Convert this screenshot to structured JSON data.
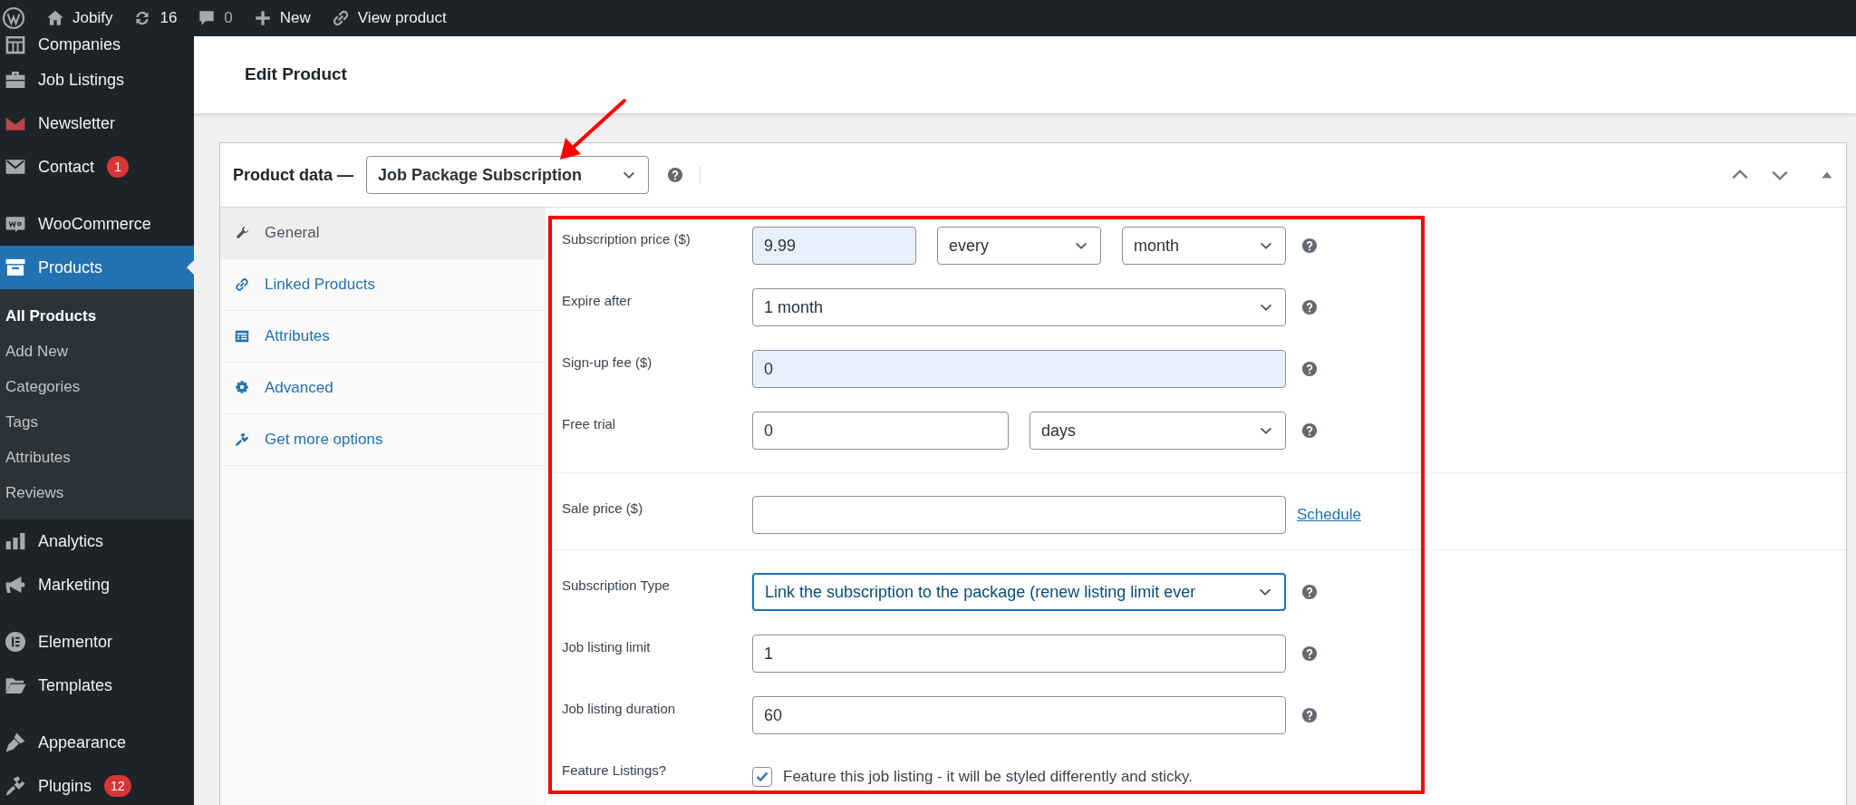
{
  "admin_bar": {
    "items": [
      {
        "kind": "wp-logo"
      },
      {
        "kind": "home",
        "label": "Jobify"
      },
      {
        "kind": "updates",
        "label": "16"
      },
      {
        "kind": "comments",
        "label": "0"
      },
      {
        "kind": "new",
        "label": "New"
      },
      {
        "kind": "link",
        "label": "View product"
      }
    ]
  },
  "sidebar": {
    "groups": [
      {
        "items": [
          {
            "kind": "companies",
            "label": "Companies",
            "selected": false
          },
          {
            "kind": "briefcase",
            "label": "Job Listings",
            "selected": false
          },
          {
            "kind": "newsletter",
            "label": "Newsletter",
            "selected": false
          },
          {
            "kind": "mail",
            "label": "Contact",
            "badge": "1",
            "selected": false
          }
        ]
      },
      {
        "items": [
          {
            "kind": "woo",
            "label": "WooCommerce",
            "selected": false
          },
          {
            "kind": "archive",
            "label": "Products",
            "selected": true,
            "children": [
              {
                "label": "All Products",
                "selected": true
              },
              {
                "label": "Add New",
                "selected": false
              },
              {
                "label": "Categories",
                "selected": false
              },
              {
                "label": "Tags",
                "selected": false
              },
              {
                "label": "Attributes",
                "selected": false
              },
              {
                "label": "Reviews",
                "selected": false
              }
            ]
          },
          {
            "kind": "chart",
            "label": "Analytics",
            "selected": false
          },
          {
            "kind": "megaphone",
            "label": "Marketing",
            "selected": false
          }
        ]
      },
      {
        "items": [
          {
            "kind": "elementor",
            "label": "Elementor",
            "selected": false
          },
          {
            "kind": "folder",
            "label": "Templates",
            "selected": false
          }
        ]
      },
      {
        "items": [
          {
            "kind": "brush",
            "label": "Appearance",
            "selected": false
          },
          {
            "kind": "plug",
            "label": "Plugins",
            "badge": "12",
            "selected": false
          }
        ]
      }
    ]
  },
  "page_title": "Edit Product",
  "product_data": {
    "label": "Product data —",
    "type_select": "Job Package Subscription",
    "tabs": [
      {
        "kind": "wrench",
        "label": "General",
        "selected": true
      },
      {
        "kind": "link",
        "label": "Linked Products",
        "selected": false
      },
      {
        "kind": "table",
        "label": "Attributes",
        "selected": false
      },
      {
        "kind": "gear",
        "label": "Advanced",
        "selected": false
      },
      {
        "kind": "plug",
        "label": "Get more options",
        "selected": false
      }
    ],
    "sections": [
      {
        "fields": [
          {
            "label": "Subscription price ($)",
            "help": true,
            "controls": [
              {
                "kind": "input",
                "value": "9.99",
                "autofilled": true
              },
              {
                "kind": "select",
                "value": "every"
              },
              {
                "kind": "select",
                "value": "month"
              }
            ]
          },
          {
            "label": "Expire after",
            "help": true,
            "controls": [
              {
                "kind": "select",
                "value": "1 month"
              }
            ]
          },
          {
            "label": "Sign-up fee ($)",
            "help": true,
            "controls": [
              {
                "kind": "input",
                "value": "0",
                "autofilled": true
              }
            ]
          },
          {
            "label": "Free trial",
            "help": true,
            "controls": [
              {
                "kind": "input",
                "value": "0",
                "autofilled": false
              },
              {
                "kind": "select",
                "value": "days"
              }
            ]
          }
        ]
      },
      {
        "fields": [
          {
            "label": "Sale price ($)",
            "help": false,
            "link": "Schedule",
            "controls": [
              {
                "kind": "input",
                "autofilled": false
              }
            ]
          }
        ]
      },
      {
        "fields": [
          {
            "label": "Subscription Type",
            "help": true,
            "controls": [
              {
                "kind": "select",
                "value": "Link the subscription to the package (renew listing limit ever",
                "focused": true
              }
            ]
          },
          {
            "label": "Job listing limit",
            "help": true,
            "controls": [
              {
                "kind": "input",
                "value": "1",
                "autofilled": false
              }
            ]
          },
          {
            "label": "Job listing duration",
            "help": true,
            "controls": [
              {
                "kind": "input",
                "value": "60",
                "autofilled": false
              }
            ]
          },
          {
            "label": "Feature Listings?",
            "help": false,
            "controls": [
              {
                "kind": "checkbox",
                "text": "Feature this job listing - it will be styled differently and sticky.",
                "checked": true
              }
            ]
          }
        ]
      }
    ]
  }
}
